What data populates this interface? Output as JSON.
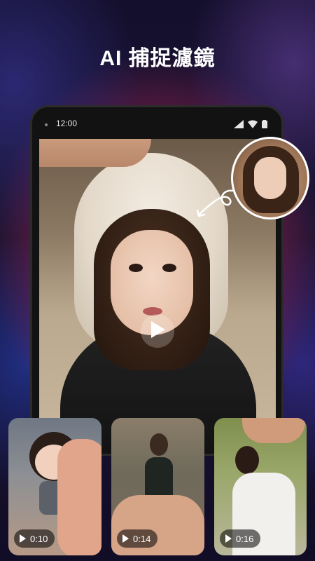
{
  "headline": "AI 捕捉濾鏡",
  "phone": {
    "status_time": "12:00",
    "main_video": {
      "icon": "play-icon"
    },
    "reference_photo": {
      "icon": "curved-arrow-icon"
    }
  },
  "thumbnails": [
    {
      "duration": "0:10",
      "icon": "play-icon"
    },
    {
      "duration": "0:14",
      "icon": "play-icon"
    },
    {
      "duration": "0:16",
      "icon": "play-icon"
    }
  ],
  "colors": {
    "background_top": "#140f2c",
    "glow_magenta": "#a0234f",
    "headline_text": "#ffffff"
  }
}
